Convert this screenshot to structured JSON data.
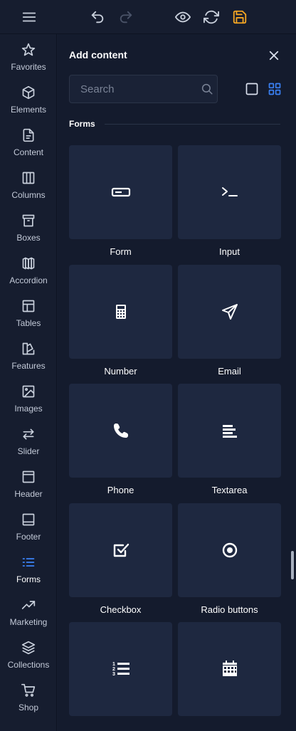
{
  "toolbar": {
    "menu_icon": "hamburger-icon",
    "undo_icon": "undo-icon",
    "redo_icon": "redo-icon",
    "preview_icon": "eye-icon",
    "refresh_icon": "refresh-icon",
    "save_icon": "save-icon",
    "save_color": "#f5a623"
  },
  "sidebar": {
    "items": [
      {
        "label": "Favorites",
        "icon": "star-icon"
      },
      {
        "label": "Elements",
        "icon": "cube-icon"
      },
      {
        "label": "Content",
        "icon": "document-icon"
      },
      {
        "label": "Columns",
        "icon": "columns-icon"
      },
      {
        "label": "Boxes",
        "icon": "box-icon"
      },
      {
        "label": "Accordion",
        "icon": "accordion-icon"
      },
      {
        "label": "Tables",
        "icon": "table-icon"
      },
      {
        "label": "Features",
        "icon": "features-icon"
      },
      {
        "label": "Images",
        "icon": "image-icon"
      },
      {
        "label": "Slider",
        "icon": "arrows-icon"
      },
      {
        "label": "Header",
        "icon": "header-icon"
      },
      {
        "label": "Footer",
        "icon": "footer-icon"
      },
      {
        "label": "Forms",
        "icon": "list-icon",
        "active": true
      },
      {
        "label": "Marketing",
        "icon": "trending-icon"
      },
      {
        "label": "Collections",
        "icon": "layers-icon"
      },
      {
        "label": "Shop",
        "icon": "cart-icon"
      }
    ],
    "active_color": "#3b82f6"
  },
  "panel": {
    "title": "Add content",
    "search_placeholder": "Search",
    "section_title": "Forms",
    "tiles": [
      {
        "label": "Form",
        "icon": "form-icon"
      },
      {
        "label": "Input",
        "icon": "terminal-icon"
      },
      {
        "label": "Number",
        "icon": "calculator-icon"
      },
      {
        "label": "Email",
        "icon": "send-icon"
      },
      {
        "label": "Phone",
        "icon": "phone-icon"
      },
      {
        "label": "Textarea",
        "icon": "align-left-icon"
      },
      {
        "label": "Checkbox",
        "icon": "checkbox-icon"
      },
      {
        "label": "Radio buttons",
        "icon": "radio-icon"
      },
      {
        "label": "",
        "icon": "ordered-list-icon"
      },
      {
        "label": "",
        "icon": "calendar-icon"
      }
    ]
  }
}
